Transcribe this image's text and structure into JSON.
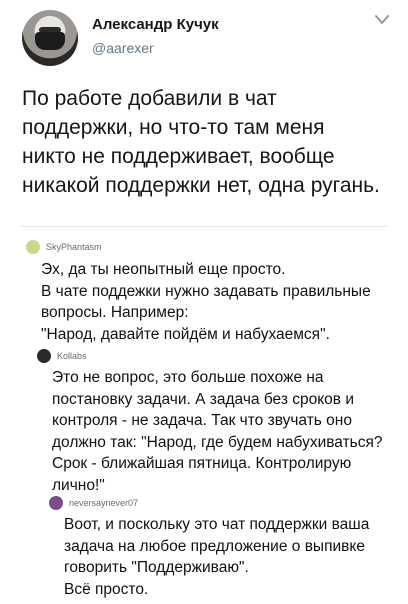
{
  "tweet": {
    "author_name": "Александр Кучук",
    "author_handle": "@aarexer",
    "text": "По работе добавили в чат поддержки, но что-то там меня никто не поддерживает, вообще никакой поддержки нет, одна ругань."
  },
  "comments": [
    {
      "username": "SkyPhantasm",
      "text": "Эх, да ты неопытный еще просто.\nВ чате поддежки нужно задавать правильные вопросы. Например:\n\"Народ, давайте пойдём и набухаемся\"."
    },
    {
      "username": "Kollabs",
      "text": "Это не вопрос, это больше похоже на постановку задачи. А задача без сроков и контроля - не задача. Так что звучать оно должно так: \"Народ, где будем набухиваться? Срок - ближайшая пятница. Контролирую лично!\""
    },
    {
      "username": "neversaynever07",
      "text": "Воот, и поскольку это чат поддержки ваша задача на любое предложение о выпивке говорить \"Поддерживаю\".\nВсё просто."
    }
  ],
  "icons": {
    "menu": "chevron-down-icon"
  }
}
